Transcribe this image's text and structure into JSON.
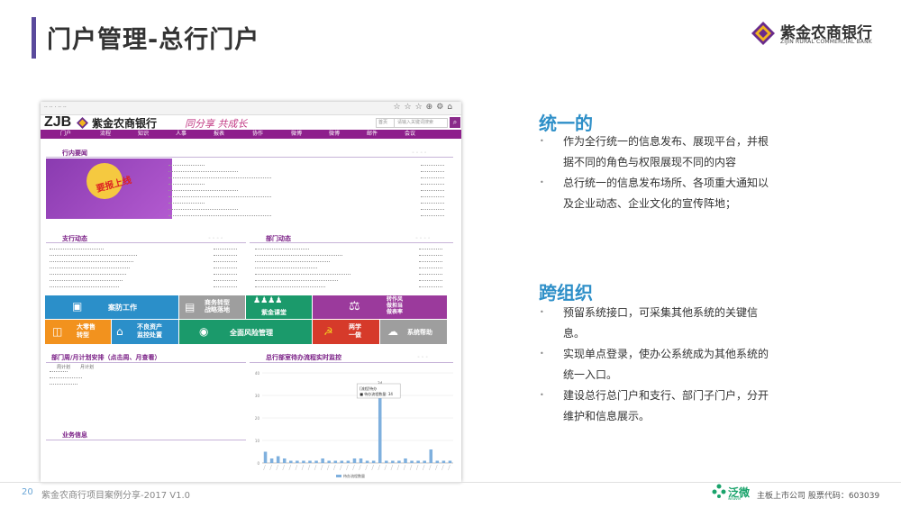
{
  "slide": {
    "title": "门户管理-总行门户",
    "page_number": "20",
    "footer": "紫金农商行项目案例分享-2017 V1.0"
  },
  "brand": {
    "name": "紫金农商银行",
    "english": "ZIJIN RURAL COMMERCIAL BANK"
  },
  "portal": {
    "logo_text": "ZJB",
    "bank_name": "紫金农商银行",
    "slogan": "同分享 共成长",
    "search_select": "首页",
    "search_placeholder": "请输入关键词搜索",
    "nav": [
      "门户",
      "流程",
      "知识",
      "人事",
      "报表",
      "协作",
      "微博",
      "微博",
      "邮件",
      "会议"
    ],
    "sections": {
      "news": "行内要闻",
      "branch": "支行动态",
      "dept": "部门动态",
      "plan": "部门周/月计划安排（点击周、月查看）",
      "flow": "总行部室待办流程实时监控",
      "business": "业务信息"
    },
    "plan_tabs": [
      "周计划",
      "月计划"
    ],
    "banner_text": "要报上线",
    "tiles": [
      {
        "label": "案防工作",
        "color": "#2b8fc9"
      },
      {
        "label": "商务转型\n战略落地",
        "color": "#9e9e9e"
      },
      {
        "label": "紫金课堂",
        "color": "#1b9a6b"
      },
      {
        "label": "转作风\n做担当\n做表率",
        "color": "#9b3a9c"
      },
      {
        "label": "大零售\n转型",
        "color": "#f2921e"
      },
      {
        "label": "不良资产\n监控处置",
        "color": "#2b8fc9"
      },
      {
        "label": "全面风险管理",
        "color": "#1b9a6b"
      },
      {
        "label": "两学\n一做",
        "color": "#d63a2a"
      },
      {
        "label": "系统帮助",
        "color": "#9e9e9e"
      }
    ],
    "chart": {
      "tooltip_title": "[流程]待办",
      "tooltip_value": "34",
      "tooltip_series": "待办流程数量",
      "peak_label": "34",
      "legend": "待办流程数量",
      "y_ticks": [
        "0",
        "10",
        "20",
        "30",
        "40"
      ]
    }
  },
  "right": {
    "h1": "统一的",
    "h1_bullets": [
      "作为全行统一的信息发布、展现平台，并根据不同的角色与权限展现不同的内容",
      "总行统一的信息发布场所、各项重大通知以及企业动态、企业文化的宣传阵地；"
    ],
    "h2": "跨组织",
    "h2_bullets": [
      "预留系统接口，可采集其他系统的关键信息。",
      "实现单点登录，使办公系统成为其他系统的统一入口。",
      "建设总行总门户和支行、部门子门户，分开维护和信息展示。"
    ]
  },
  "vendor": {
    "name": "泛微",
    "english": "weaver",
    "listing": "主板上市公司  股票代码：603039"
  },
  "chart_data": {
    "type": "bar",
    "title": "总行部室待办流程实时监控",
    "ylim": [
      0,
      40
    ],
    "y_ticks": [
      0,
      10,
      20,
      30,
      40
    ],
    "values": [
      5,
      2,
      3,
      2,
      1,
      1,
      1,
      1,
      1,
      2,
      1,
      1,
      1,
      1,
      2,
      2,
      1,
      1,
      34,
      1,
      1,
      1,
      2,
      1,
      1,
      1,
      6,
      1,
      1,
      1
    ],
    "labeled_values": [
      34
    ],
    "series": [
      {
        "name": "待办流程数量"
      }
    ],
    "legend": "bottom"
  }
}
